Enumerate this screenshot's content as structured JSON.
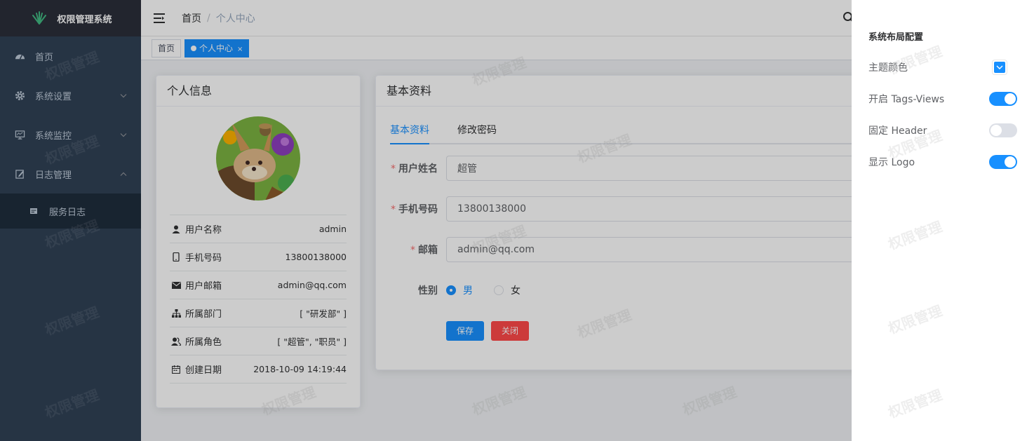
{
  "app": {
    "title": "权限管理系统"
  },
  "watermark": "权限管理",
  "sidebar": {
    "items": [
      {
        "label": "首页",
        "icon": "dashboard-icon"
      },
      {
        "label": "系统设置",
        "icon": "gear-icon"
      },
      {
        "label": "系统监控",
        "icon": "monitor-icon"
      },
      {
        "label": "日志管理",
        "icon": "edit-icon"
      }
    ],
    "submenu": [
      {
        "label": "服务日志",
        "icon": "log-icon"
      }
    ]
  },
  "navbar": {
    "breadcrumb_home": "首页",
    "breadcrumb_sep": "/",
    "breadcrumb_current": "个人中心"
  },
  "tags": [
    {
      "label": "首页"
    },
    {
      "label": "个人中心",
      "close": "×"
    }
  ],
  "profile": {
    "title": "个人信息",
    "rows": [
      {
        "label": "用户名称",
        "value": "admin",
        "icon": "user-icon"
      },
      {
        "label": "手机号码",
        "value": "13800138000",
        "icon": "phone-icon"
      },
      {
        "label": "用户邮箱",
        "value": "admin@qq.com",
        "icon": "mail-icon"
      },
      {
        "label": "所属部门",
        "value": "[ \"研发部\" ]",
        "icon": "tree-icon"
      },
      {
        "label": "所属角色",
        "value": "[ \"超管\", \"职员\" ]",
        "icon": "peoples-icon"
      },
      {
        "label": "创建日期",
        "value": "2018-10-09 14:19:44",
        "icon": "date-icon"
      }
    ]
  },
  "basic": {
    "title": "基本资料",
    "tabs": [
      {
        "label": "基本资料"
      },
      {
        "label": "修改密码"
      }
    ],
    "fields": {
      "username_label": "用户姓名",
      "username_value": "超管",
      "phone_label": "手机号码",
      "phone_value": "13800138000",
      "email_label": "邮箱",
      "email_value": "admin@qq.com",
      "gender_label": "性别",
      "gender_male": "男",
      "gender_female": "女",
      "required_mark": "*"
    },
    "save_label": "保存",
    "close_label": "关闭"
  },
  "drawer": {
    "title": "系统布局配置",
    "theme_label": "主题颜色",
    "theme_color": "#1890ff",
    "tags_label": "开启 Tags-Views",
    "tags_on": true,
    "header_label": "固定 Header",
    "header_on": false,
    "logo_label": "显示 Logo",
    "logo_on": true
  },
  "colors": {
    "sidebar_bg": "#304156",
    "accent": "#1890ff",
    "danger": "#ff4949"
  }
}
